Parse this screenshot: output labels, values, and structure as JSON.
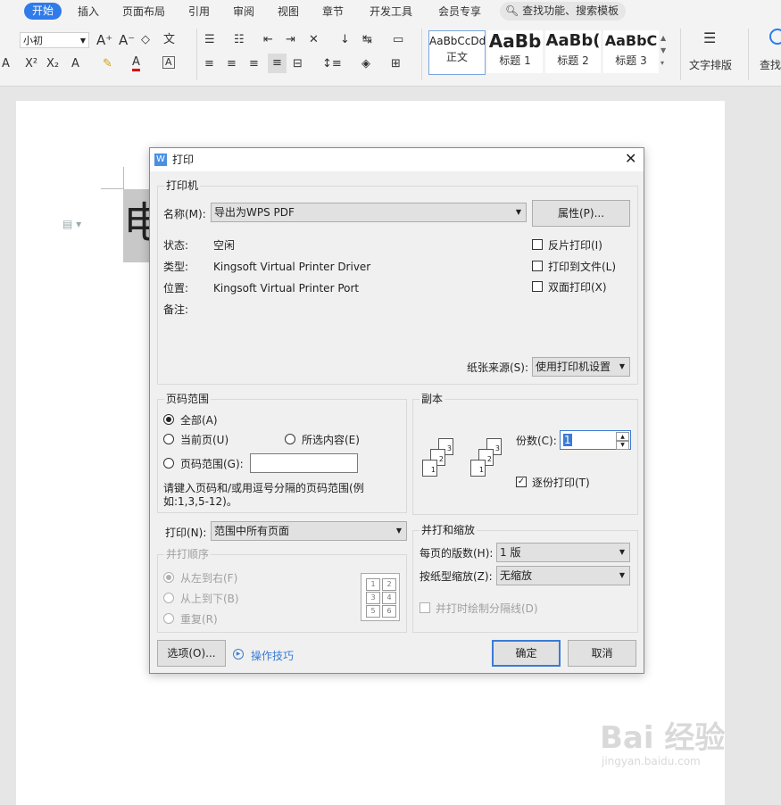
{
  "ribbon": {
    "tabs": [
      "开始",
      "插入",
      "页面布局",
      "引用",
      "审阅",
      "视图",
      "章节",
      "开发工具",
      "会员专享"
    ],
    "active_tab": "开始",
    "search_label": "查找功能、搜索模板",
    "font_size_value": "小初",
    "styles": [
      {
        "preview": "AaBbCcDd",
        "name": "正文"
      },
      {
        "preview": "AaBb",
        "name": "标题 1"
      },
      {
        "preview": "AaBb(",
        "name": "标题 2"
      },
      {
        "preview": "AaBbC",
        "name": "标题 3"
      }
    ],
    "text_layout_label": "文字排版",
    "find_label": "查找"
  },
  "document": {
    "visible_char": "电"
  },
  "dialog": {
    "title": "打印",
    "printer": {
      "group_label": "打印机",
      "name_label": "名称(M):",
      "name_value": "导出为WPS PDF",
      "properties_button": "属性(P)...",
      "status_label": "状态:",
      "status_value": "空闲",
      "type_label": "类型:",
      "type_value": "Kingsoft Virtual Printer Driver",
      "where_label": "位置:",
      "where_value": "Kingsoft Virtual Printer Port",
      "comment_label": "备注:",
      "reverse_print": "反片打印(I)",
      "print_to_file": "打印到文件(L)",
      "duplex": "双面打印(X)",
      "paper_source_label": "纸张来源(S):",
      "paper_source_value": "使用打印机设置"
    },
    "page_range": {
      "group_label": "页码范围",
      "all": "全部(A)",
      "current": "当前页(U)",
      "selection": "所选内容(E)",
      "pages": "页码范围(G):",
      "hint": "请键入页码和/或用逗号分隔的页码范围(例如:1,3,5-12)。",
      "selected": "all"
    },
    "copies": {
      "group_label": "副本",
      "count_label": "份数(C):",
      "count_value": "1",
      "collate_label": "逐份打印(T)",
      "collate_checked": true,
      "stack_a": [
        "3",
        "2",
        "1"
      ],
      "stack_b": [
        "3",
        "2",
        "1"
      ]
    },
    "print_what": {
      "label": "打印(N):",
      "value": "范围中所有页面"
    },
    "order": {
      "group_label": "并打顺序",
      "left_to_right": "从左到右(F)",
      "top_to_bottom": "从上到下(B)",
      "repeat": "重复(R)",
      "preview_numbers": [
        "1",
        "2",
        "3",
        "4",
        "5",
        "6"
      ]
    },
    "zoom": {
      "group_label": "并打和缩放",
      "pages_per_sheet_label": "每页的版数(H):",
      "pages_per_sheet_value": "1 版",
      "scale_label": "按纸型缩放(Z):",
      "scale_value": "无缩放",
      "draw_borders": "并打时绘制分隔线(D)"
    },
    "buttons": {
      "options": "选项(O)...",
      "tips": "操作技巧",
      "ok": "确定",
      "cancel": "取消"
    }
  },
  "watermark": {
    "line1": "Bai 经验",
    "line2": "jingyan.baidu.com"
  },
  "colors": {
    "accent": "#2f7bea",
    "dialog_bg": "#f0f0f0",
    "link": "#3a7bd5"
  }
}
